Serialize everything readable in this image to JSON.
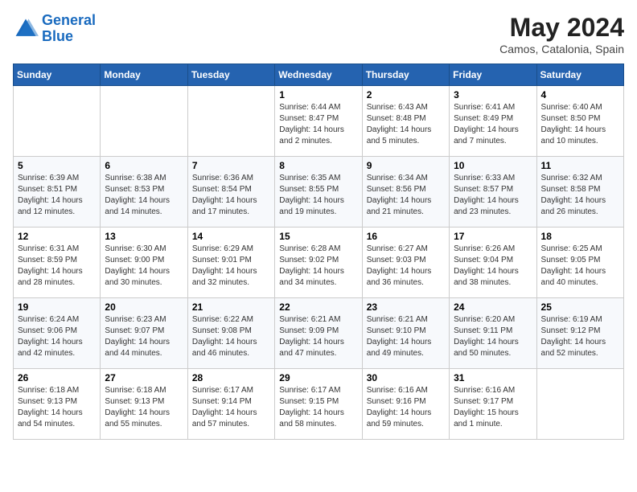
{
  "header": {
    "logo_line1": "General",
    "logo_line2": "Blue",
    "month": "May 2024",
    "location": "Camos, Catalonia, Spain"
  },
  "weekdays": [
    "Sunday",
    "Monday",
    "Tuesday",
    "Wednesday",
    "Thursday",
    "Friday",
    "Saturday"
  ],
  "weeks": [
    [
      {
        "day": "",
        "info": ""
      },
      {
        "day": "",
        "info": ""
      },
      {
        "day": "",
        "info": ""
      },
      {
        "day": "1",
        "info": "Sunrise: 6:44 AM\nSunset: 8:47 PM\nDaylight: 14 hours\nand 2 minutes."
      },
      {
        "day": "2",
        "info": "Sunrise: 6:43 AM\nSunset: 8:48 PM\nDaylight: 14 hours\nand 5 minutes."
      },
      {
        "day": "3",
        "info": "Sunrise: 6:41 AM\nSunset: 8:49 PM\nDaylight: 14 hours\nand 7 minutes."
      },
      {
        "day": "4",
        "info": "Sunrise: 6:40 AM\nSunset: 8:50 PM\nDaylight: 14 hours\nand 10 minutes."
      }
    ],
    [
      {
        "day": "5",
        "info": "Sunrise: 6:39 AM\nSunset: 8:51 PM\nDaylight: 14 hours\nand 12 minutes."
      },
      {
        "day": "6",
        "info": "Sunrise: 6:38 AM\nSunset: 8:53 PM\nDaylight: 14 hours\nand 14 minutes."
      },
      {
        "day": "7",
        "info": "Sunrise: 6:36 AM\nSunset: 8:54 PM\nDaylight: 14 hours\nand 17 minutes."
      },
      {
        "day": "8",
        "info": "Sunrise: 6:35 AM\nSunset: 8:55 PM\nDaylight: 14 hours\nand 19 minutes."
      },
      {
        "day": "9",
        "info": "Sunrise: 6:34 AM\nSunset: 8:56 PM\nDaylight: 14 hours\nand 21 minutes."
      },
      {
        "day": "10",
        "info": "Sunrise: 6:33 AM\nSunset: 8:57 PM\nDaylight: 14 hours\nand 23 minutes."
      },
      {
        "day": "11",
        "info": "Sunrise: 6:32 AM\nSunset: 8:58 PM\nDaylight: 14 hours\nand 26 minutes."
      }
    ],
    [
      {
        "day": "12",
        "info": "Sunrise: 6:31 AM\nSunset: 8:59 PM\nDaylight: 14 hours\nand 28 minutes."
      },
      {
        "day": "13",
        "info": "Sunrise: 6:30 AM\nSunset: 9:00 PM\nDaylight: 14 hours\nand 30 minutes."
      },
      {
        "day": "14",
        "info": "Sunrise: 6:29 AM\nSunset: 9:01 PM\nDaylight: 14 hours\nand 32 minutes."
      },
      {
        "day": "15",
        "info": "Sunrise: 6:28 AM\nSunset: 9:02 PM\nDaylight: 14 hours\nand 34 minutes."
      },
      {
        "day": "16",
        "info": "Sunrise: 6:27 AM\nSunset: 9:03 PM\nDaylight: 14 hours\nand 36 minutes."
      },
      {
        "day": "17",
        "info": "Sunrise: 6:26 AM\nSunset: 9:04 PM\nDaylight: 14 hours\nand 38 minutes."
      },
      {
        "day": "18",
        "info": "Sunrise: 6:25 AM\nSunset: 9:05 PM\nDaylight: 14 hours\nand 40 minutes."
      }
    ],
    [
      {
        "day": "19",
        "info": "Sunrise: 6:24 AM\nSunset: 9:06 PM\nDaylight: 14 hours\nand 42 minutes."
      },
      {
        "day": "20",
        "info": "Sunrise: 6:23 AM\nSunset: 9:07 PM\nDaylight: 14 hours\nand 44 minutes."
      },
      {
        "day": "21",
        "info": "Sunrise: 6:22 AM\nSunset: 9:08 PM\nDaylight: 14 hours\nand 46 minutes."
      },
      {
        "day": "22",
        "info": "Sunrise: 6:21 AM\nSunset: 9:09 PM\nDaylight: 14 hours\nand 47 minutes."
      },
      {
        "day": "23",
        "info": "Sunrise: 6:21 AM\nSunset: 9:10 PM\nDaylight: 14 hours\nand 49 minutes."
      },
      {
        "day": "24",
        "info": "Sunrise: 6:20 AM\nSunset: 9:11 PM\nDaylight: 14 hours\nand 50 minutes."
      },
      {
        "day": "25",
        "info": "Sunrise: 6:19 AM\nSunset: 9:12 PM\nDaylight: 14 hours\nand 52 minutes."
      }
    ],
    [
      {
        "day": "26",
        "info": "Sunrise: 6:18 AM\nSunset: 9:13 PM\nDaylight: 14 hours\nand 54 minutes."
      },
      {
        "day": "27",
        "info": "Sunrise: 6:18 AM\nSunset: 9:13 PM\nDaylight: 14 hours\nand 55 minutes."
      },
      {
        "day": "28",
        "info": "Sunrise: 6:17 AM\nSunset: 9:14 PM\nDaylight: 14 hours\nand 57 minutes."
      },
      {
        "day": "29",
        "info": "Sunrise: 6:17 AM\nSunset: 9:15 PM\nDaylight: 14 hours\nand 58 minutes."
      },
      {
        "day": "30",
        "info": "Sunrise: 6:16 AM\nSunset: 9:16 PM\nDaylight: 14 hours\nand 59 minutes."
      },
      {
        "day": "31",
        "info": "Sunrise: 6:16 AM\nSunset: 9:17 PM\nDaylight: 15 hours\nand 1 minute."
      },
      {
        "day": "",
        "info": ""
      }
    ]
  ]
}
